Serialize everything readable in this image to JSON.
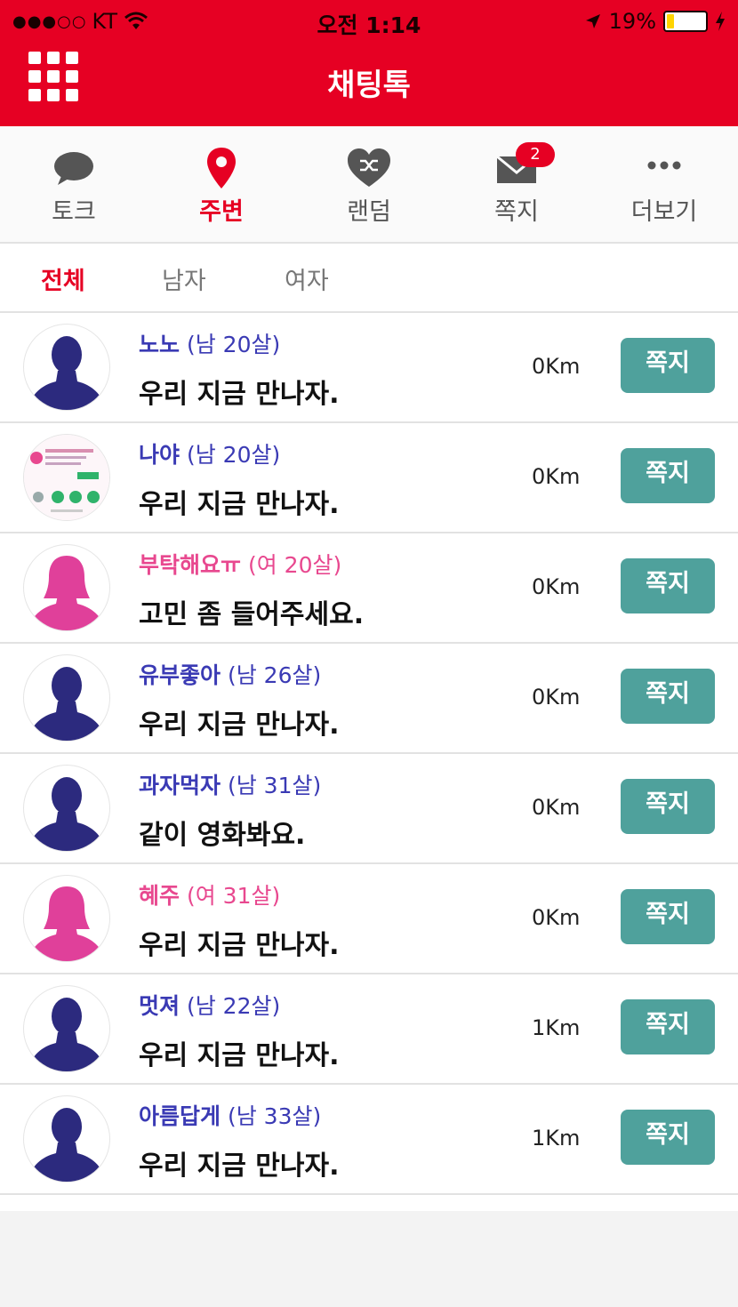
{
  "status_bar": {
    "signal": "●●●○○",
    "carrier": "KT",
    "time": "오전 1:14",
    "battery_percent": "19%",
    "battery_level": 0.19
  },
  "header": {
    "title": "채팅톡",
    "menu_icon": "grid-menu-icon"
  },
  "tabs": [
    {
      "label": "토크",
      "icon": "speech-bubble-icon",
      "active": false
    },
    {
      "label": "주변",
      "icon": "location-pin-icon",
      "active": true
    },
    {
      "label": "랜덤",
      "icon": "shuffle-heart-icon",
      "active": false
    },
    {
      "label": "쪽지",
      "icon": "envelope-icon",
      "badge": "2",
      "active": false
    },
    {
      "label": "더보기",
      "icon": "more-dots-icon",
      "active": false
    }
  ],
  "filters": [
    {
      "label": "전체",
      "active": true
    },
    {
      "label": "남자",
      "active": false
    },
    {
      "label": "여자",
      "active": false
    }
  ],
  "users": [
    {
      "nickname": "노노",
      "info": "(남 20살)",
      "gender": "male",
      "message": "우리 지금 만나자.",
      "distance": "0Km",
      "button": "쪽지",
      "avatar": "male-silhouette"
    },
    {
      "nickname": "나야",
      "info": "(남 20살)",
      "gender": "male",
      "message": "우리 지금 만나자.",
      "distance": "0Km",
      "button": "쪽지",
      "avatar": "photo-thumbnail"
    },
    {
      "nickname": "부탁해요ㅠ",
      "info": "(여 20살)",
      "gender": "female",
      "message": "고민 좀 들어주세요.",
      "distance": "0Km",
      "button": "쪽지",
      "avatar": "female-silhouette"
    },
    {
      "nickname": "유부좋아",
      "info": "(남 26살)",
      "gender": "male",
      "message": "우리 지금 만나자.",
      "distance": "0Km",
      "button": "쪽지",
      "avatar": "male-silhouette"
    },
    {
      "nickname": "과자먹자",
      "info": "(남 31살)",
      "gender": "male",
      "message": "같이 영화봐요.",
      "distance": "0Km",
      "button": "쪽지",
      "avatar": "male-silhouette"
    },
    {
      "nickname": "혜주",
      "info": "(여 31살)",
      "gender": "female",
      "message": "우리 지금 만나자.",
      "distance": "0Km",
      "button": "쪽지",
      "avatar": "female-silhouette"
    },
    {
      "nickname": "멋져",
      "info": "(남 22살)",
      "gender": "male",
      "message": "우리 지금 만나자.",
      "distance": "1Km",
      "button": "쪽지",
      "avatar": "male-silhouette"
    },
    {
      "nickname": "아름답게",
      "info": "(남 33살)",
      "gender": "male",
      "message": "우리 지금 만나자.",
      "distance": "1Km",
      "button": "쪽지",
      "avatar": "male-silhouette"
    }
  ],
  "colors": {
    "brand_red": "#e60023",
    "button_teal": "#4fa19c",
    "male_name": "#3a3ab4",
    "female_name": "#e8488f",
    "male_avatar": "#2c2a7e",
    "female_avatar": "#e0409a"
  }
}
